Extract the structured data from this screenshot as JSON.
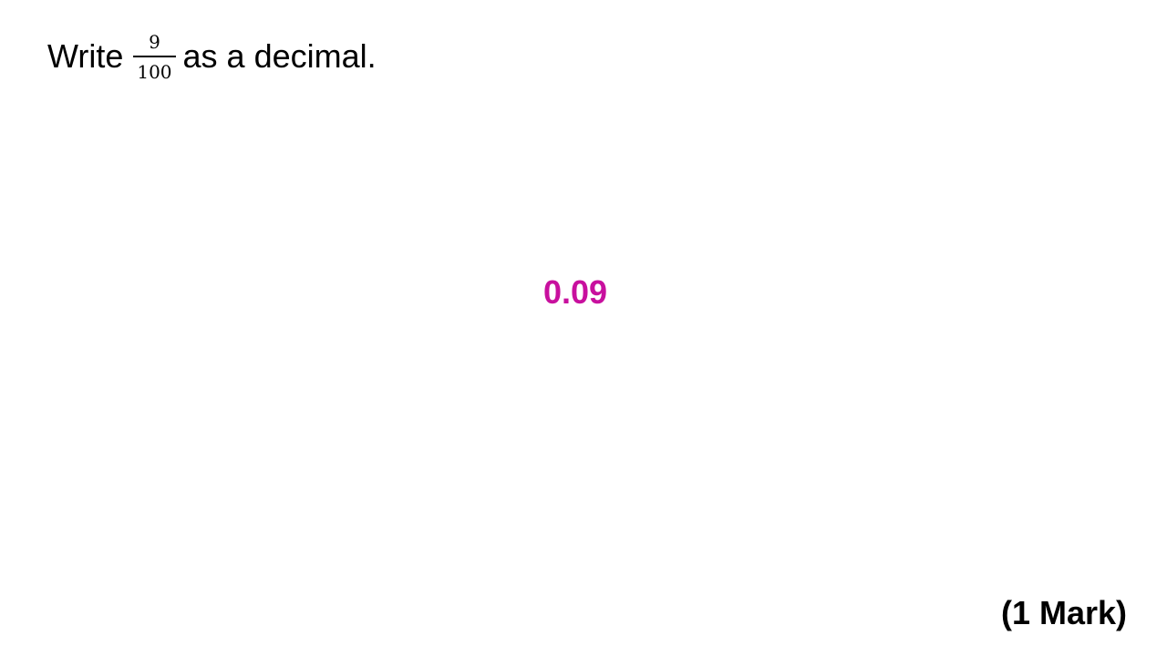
{
  "question": {
    "prefix": "Write",
    "fraction": {
      "numerator": "9",
      "denominator": "100"
    },
    "suffix": "as a decimal."
  },
  "answer": {
    "text": "0.09",
    "color": "#c8109e"
  },
  "marks": {
    "text": "(1 Mark)"
  }
}
